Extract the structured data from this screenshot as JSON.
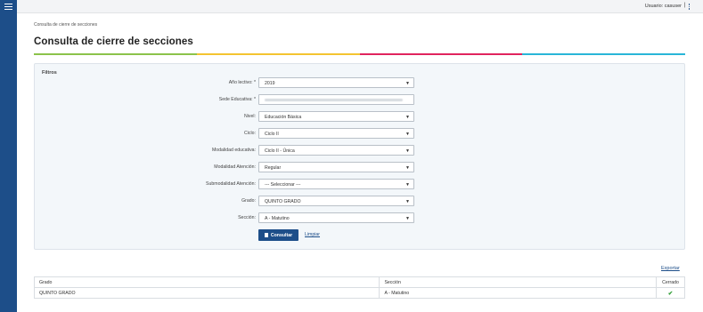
{
  "topbar": {
    "user_label": "Usuario: casuser",
    "separator": "|",
    "menu_icon": "hamburger-icon",
    "more_icon": "kebab-icon"
  },
  "breadcrumb": "Consulta de cierre de secciones",
  "page_title": "Consulta de cierre de secciones",
  "rule_colors": [
    "#8bc34a",
    "#f4c430",
    "#e0245e",
    "#29b6d8"
  ],
  "filters": {
    "title": "Filtros",
    "fields": [
      {
        "label": "Año lectivo: *",
        "value": "2019",
        "type": "select"
      },
      {
        "label": "Sede Educativa: *",
        "value": "",
        "type": "input"
      },
      {
        "label": "Nivel:",
        "value": "Educación Básica",
        "type": "select"
      },
      {
        "label": "Ciclo:",
        "value": "Ciclo II",
        "type": "select"
      },
      {
        "label": "Modalidad educativa:",
        "value": "Ciclo II - Única",
        "type": "select"
      },
      {
        "label": "Modalidad Atención:",
        "value": "Regular",
        "type": "select"
      },
      {
        "label": "Submodalidad Atención:",
        "value": "--- Seleccionar ---",
        "type": "select"
      },
      {
        "label": "Grado:",
        "value": "QUINTO GRADO",
        "type": "select"
      },
      {
        "label": "Sección:",
        "value": "A - Matutino",
        "type": "select"
      }
    ],
    "consultar_label": "Consultar",
    "limpiar_label": "Limpiar"
  },
  "export_label": "Exportar",
  "table": {
    "columns": [
      "Grado",
      "Sección",
      "Cerrado"
    ],
    "rows": [
      {
        "grado": "QUINTO GRADO",
        "seccion": "A - Matutino",
        "cerrado": "✔"
      }
    ]
  }
}
